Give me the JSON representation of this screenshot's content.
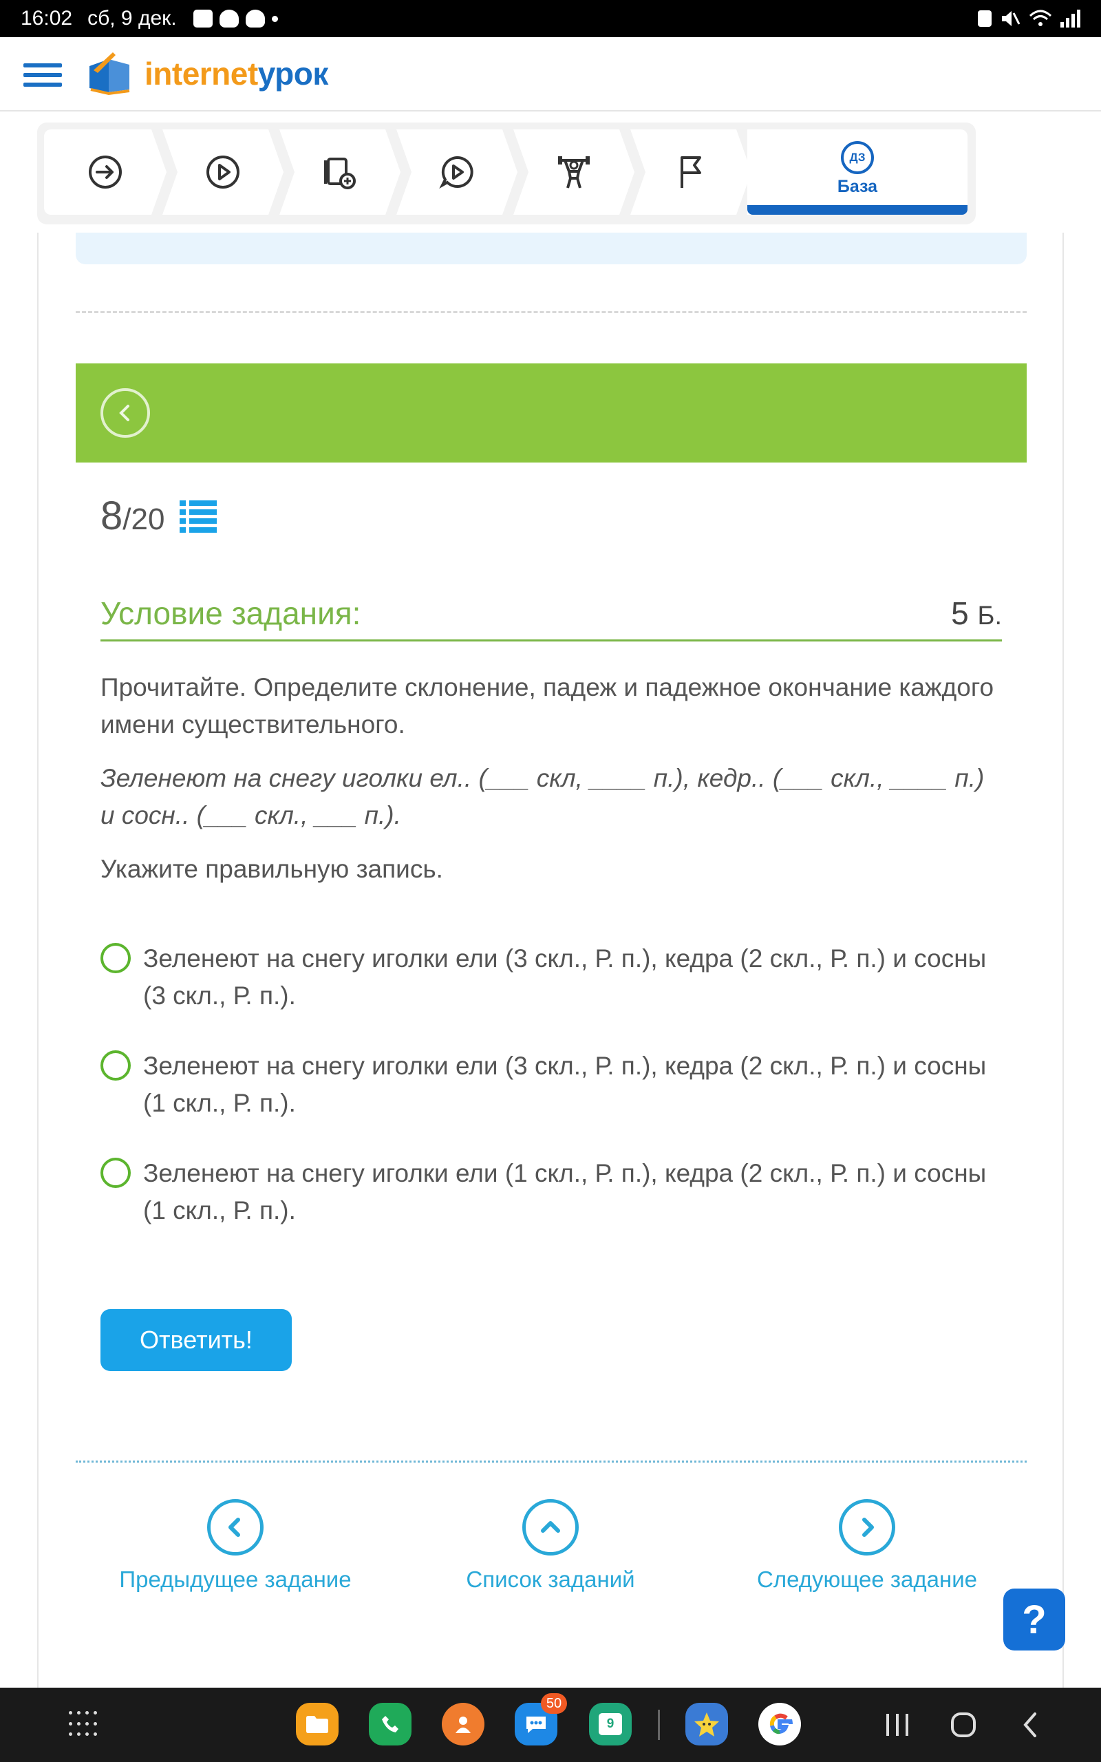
{
  "status_bar": {
    "time": "16:02",
    "date": "сб, 9 дек."
  },
  "header": {
    "logo_part1": "internet",
    "logo_part2": "урок"
  },
  "lesson_tabs": {
    "items": [
      {
        "icon": "arrow-right-circle-icon"
      },
      {
        "icon": "play-circle-icon"
      },
      {
        "icon": "notes-add-icon"
      },
      {
        "icon": "chat-play-icon"
      },
      {
        "icon": "weightlifter-icon"
      },
      {
        "icon": "flag-icon"
      }
    ],
    "active": {
      "badge": "ДЗ",
      "label": "База"
    }
  },
  "task": {
    "number": "8",
    "total": "/20",
    "condition_title": "Условие задания:",
    "points": "5",
    "points_unit": "Б.",
    "instruction": "Прочитайте. Определите склонение, падеж и падежное окончание каждого имени существительного.",
    "sentence": "Зеленеют на снегу иголки ел.. (___ скл, ____ п.), кедр.. (___ скл., ____ п.) и сосн.. (___ скл., ___ п.).",
    "prompt": "Укажите правильную запись.",
    "options": [
      "Зеленеют на снегу иголки ели (3 скл., Р. п.), кедра (2 скл., Р. п.) и сосны (3 скл., Р. п.).",
      "Зеленеют на снегу иголки ели (3 скл., Р. п.), кедра (2 скл., Р. п.) и сосны (1 скл., Р. п.).",
      "Зеленеют на снегу иголки ели (1 скл., Р. п.), кедра (2 скл., Р. п.) и сосны (1 скл., Р. п.)."
    ],
    "submit_label": "Ответить!"
  },
  "bottom_nav": {
    "prev_label": "Предыдущее задание",
    "list_label": "Список заданий",
    "next_label": "Следующее задание"
  },
  "help_label": "?",
  "dock": {
    "messages_badge": "50",
    "calendar_day": "9"
  },
  "colors": {
    "brand_blue": "#1a6fc4",
    "brand_orange": "#f39a1a",
    "green": "#8cc63f",
    "link_blue": "#29a8d8",
    "button_blue": "#1aa3e8"
  }
}
